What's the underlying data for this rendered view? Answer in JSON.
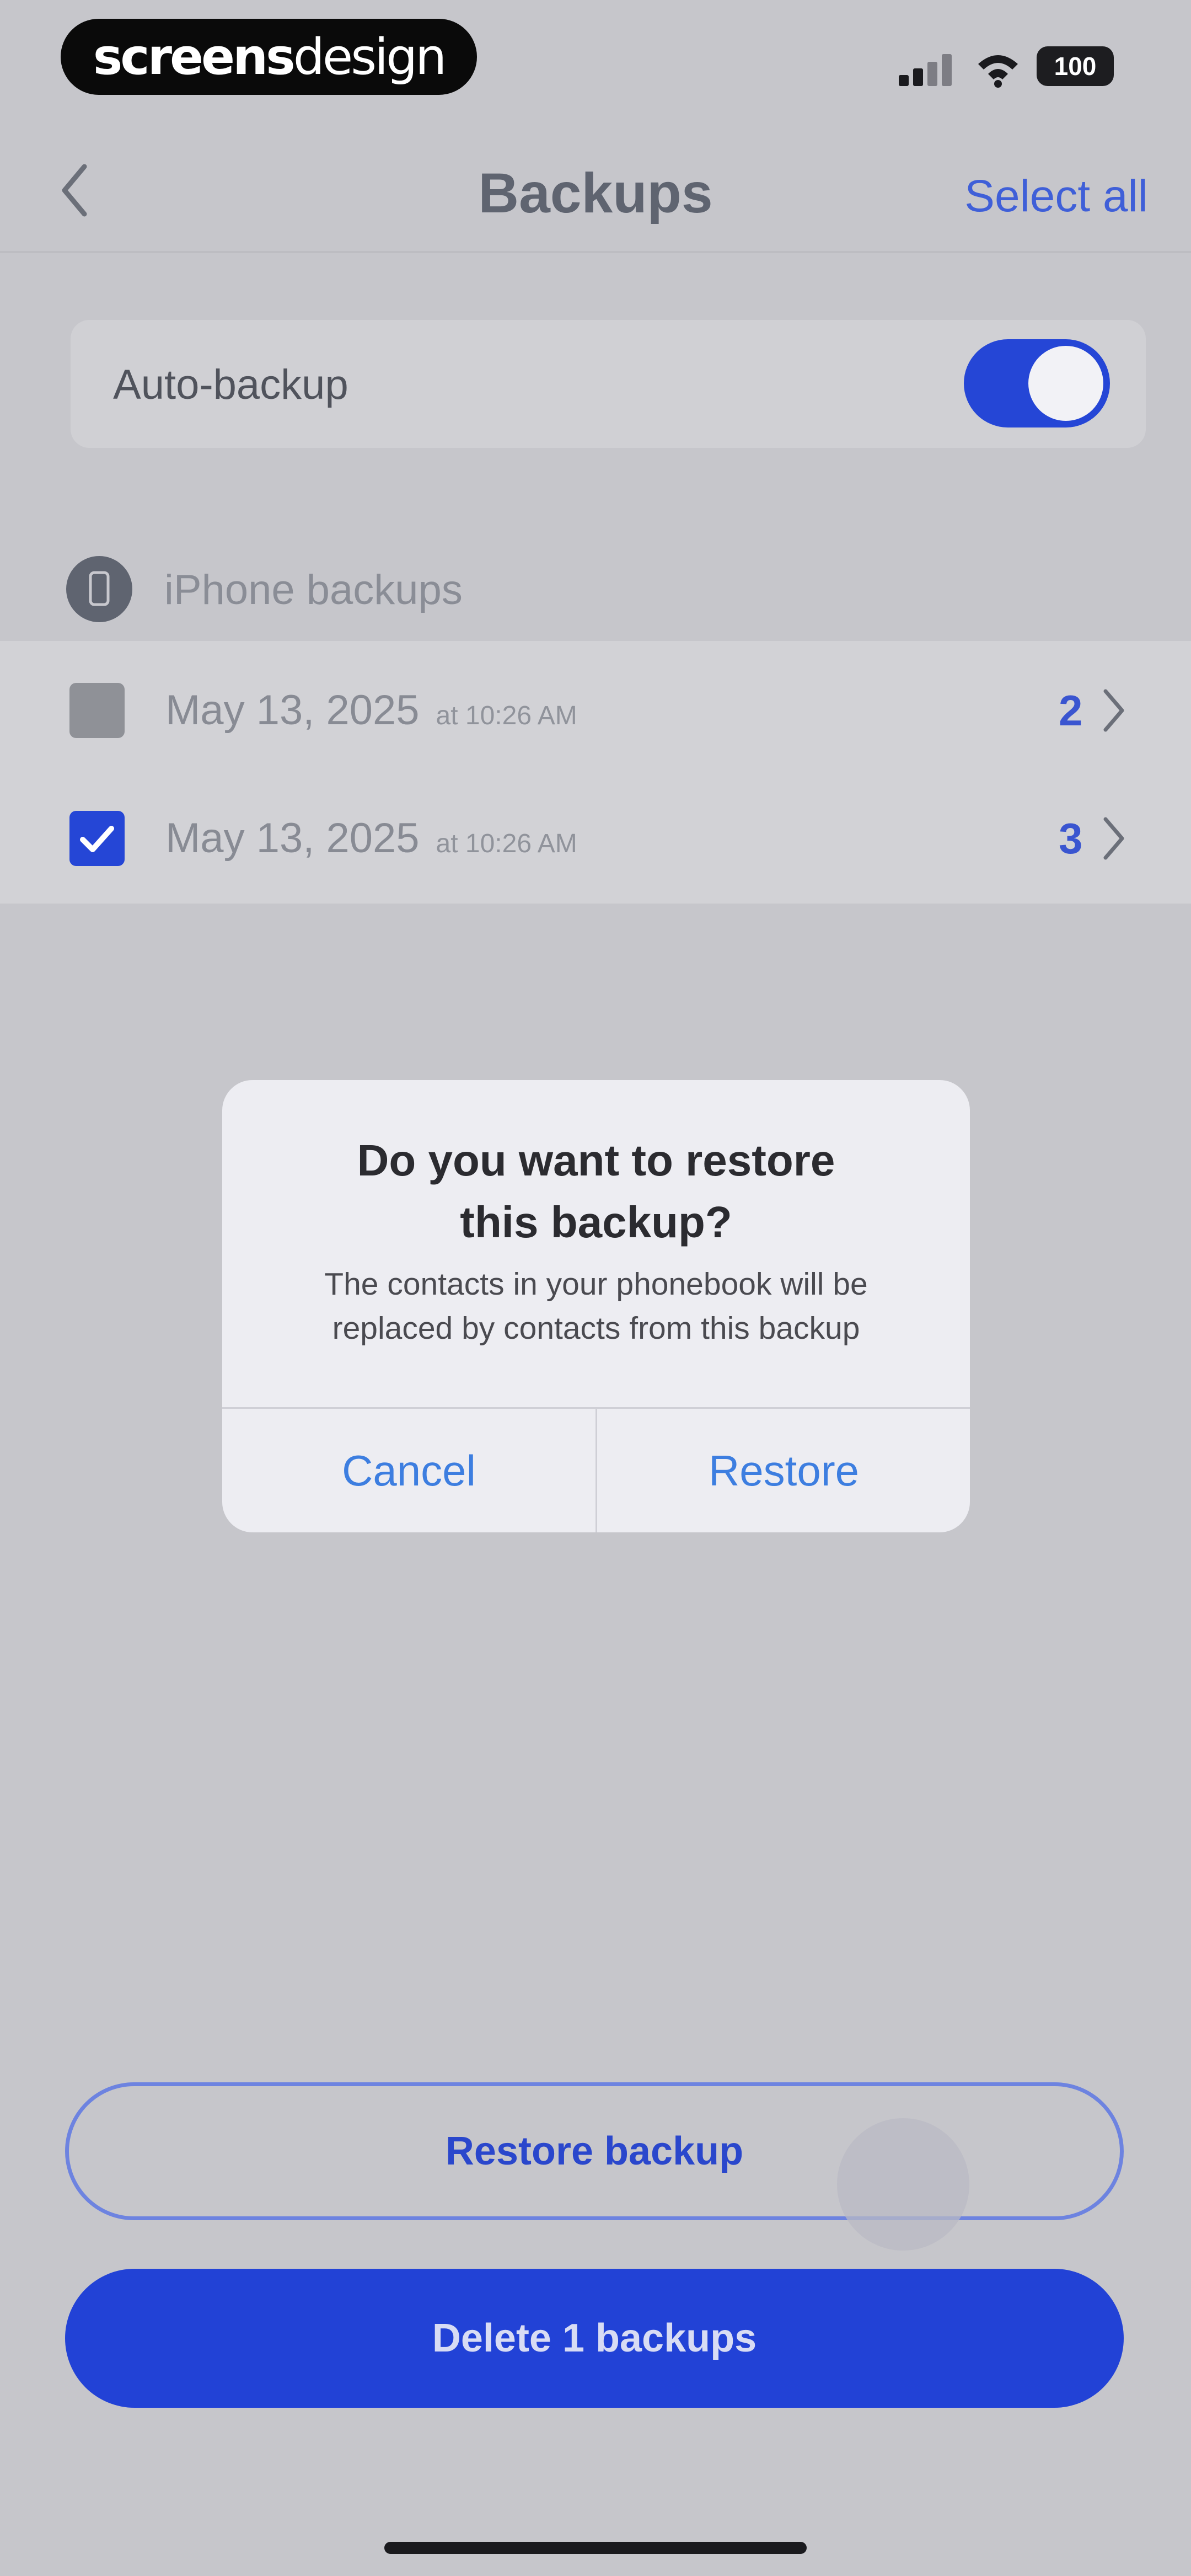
{
  "status_bar": {
    "brand_bold": "screens",
    "brand_light": "design",
    "battery": "100"
  },
  "nav": {
    "title": "Backups",
    "select_all": "Select all"
  },
  "auto_backup": {
    "label": "Auto-backup",
    "enabled": true
  },
  "section": {
    "title": "iPhone backups"
  },
  "backups": [
    {
      "date": "May 13, 2025",
      "time": "at 10:26 AM",
      "count": "2",
      "checked": false
    },
    {
      "date": "May 13, 2025",
      "time": "at 10:26 AM",
      "count": "3",
      "checked": true
    }
  ],
  "dialog": {
    "title": "Do you want to restore\nthis backup?",
    "message": "The contacts in your phonebook will be\nreplaced by contacts from this backup",
    "cancel": "Cancel",
    "restore": "Restore"
  },
  "actions": {
    "restore_label": "Restore backup",
    "delete_label": "Delete 1 backups"
  },
  "colors": {
    "accent": "#2546d6",
    "background": "#c6c6cb",
    "dialog_link": "#3d7ee0"
  }
}
